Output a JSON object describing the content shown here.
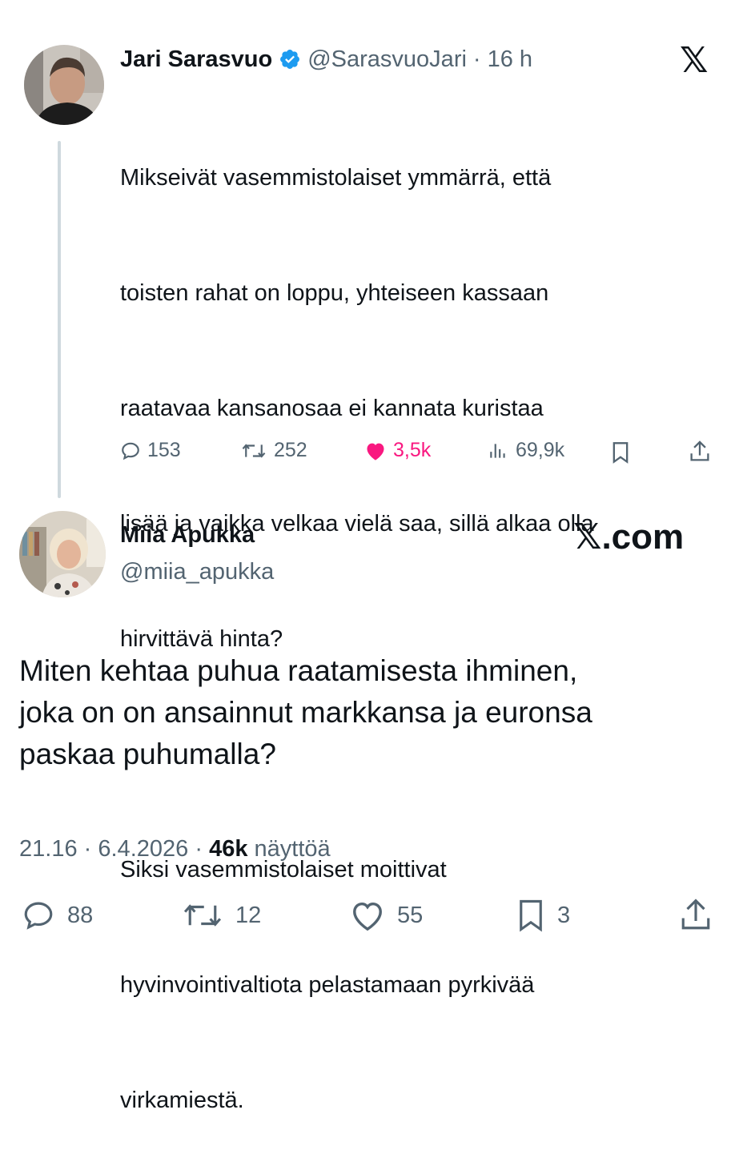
{
  "tweet1": {
    "author_name": "Jari Sarasvuo",
    "handle": "@SarasvuoJari",
    "sep": "·",
    "time": "16 h",
    "text": "Mikseivät vasemmistolaiset ymmärrä, että toisten rahat on loppu, yhteiseen kassaan raatavaa kansanosaa ei kannata kuristaa lisää ja vaikka velkaa vielä saa, sillä alkaa olla hirvittävä hinta?\n\nSiksi vasemmistolaiset moittivat hyvinvointivaltiota pelastamaan pyrkivää virkamiestä.",
    "text_lines": [
      "Mikseivät vasemmistolaiset ymmärrä, että",
      "toisten rahat on loppu, yhteiseen kassaan",
      "raatavaa kansanosaa ei kannata kuristaa",
      "lisää ja vaikka velkaa vielä saa, sillä alkaa olla",
      "hirvittävä hinta?",
      "",
      "Siksi vasemmistolaiset moittivat",
      "hyvinvointivaltiota pelastamaan pyrkivää",
      "virkamiestä."
    ],
    "replies": "153",
    "reposts": "252",
    "likes": "3,5k",
    "views": "69,9k",
    "like_color": "#f91880"
  },
  "logo_mark": "𝕏",
  "tweet2": {
    "author_name": "Miia Apukka",
    "handle": "@miia_apukka",
    "brand": "𝕏.com",
    "text_lines": [
      "Miten kehtaa puhua raatamisesta ihminen,",
      "joka on on ansainnut markkansa ja euronsa",
      "paskaa puhumalla?"
    ],
    "time": "21.16",
    "sep": "·",
    "date": "6.4.2026",
    "views_count": "46k",
    "views_label": "näyttöä",
    "replies": "88",
    "reposts": "12",
    "likes": "55",
    "bookmarks": "3"
  },
  "colors": {
    "text": "#0f1419",
    "secondary": "#536471",
    "verified": "#1d9bf0",
    "thread_line": "#cfd9de"
  },
  "icons": [
    "verified-badge-icon",
    "x-logo-icon",
    "reply-icon",
    "repost-icon",
    "like-icon",
    "views-icon",
    "bookmark-icon",
    "share-icon"
  ]
}
